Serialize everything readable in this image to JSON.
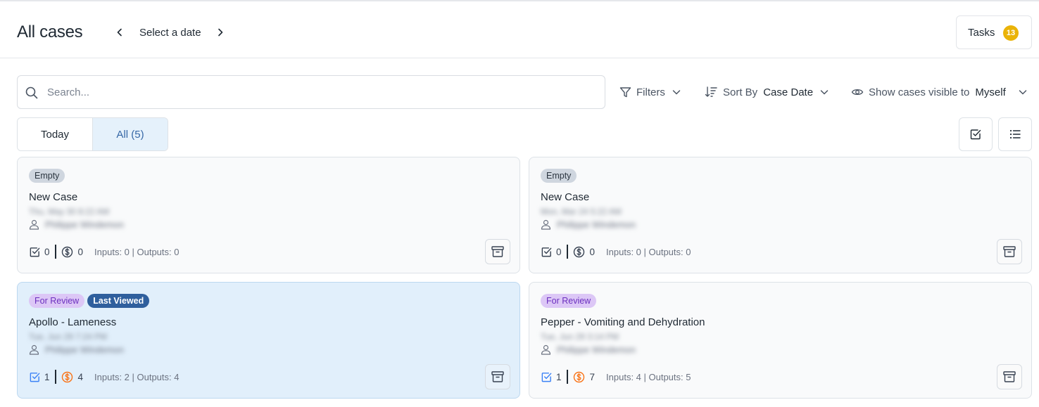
{
  "header": {
    "title": "All cases",
    "date_picker": {
      "label": "Select a date"
    },
    "tasks": {
      "label": "Tasks",
      "count": "13"
    }
  },
  "search": {
    "placeholder": "Search..."
  },
  "toolbar": {
    "filters_label": "Filters",
    "sort_label": "Sort By",
    "sort_value": "Case Date",
    "visibility_label": "Show cases visible to",
    "visibility_value": "Myself"
  },
  "tabs": [
    {
      "label": "Today",
      "selected": false
    },
    {
      "label": "All (5)",
      "selected": true
    }
  ],
  "cases": [
    {
      "badges": [
        {
          "label": "Empty",
          "kind": "empty"
        }
      ],
      "title": "New Case",
      "date": "Thu, May 30 8:22 AM",
      "owner": "Philippe Windemon",
      "tasks": "0",
      "credits": "0",
      "io": "Inputs: 0 | Outputs: 0",
      "active": false
    },
    {
      "badges": [
        {
          "label": "Empty",
          "kind": "empty"
        }
      ],
      "title": "New Case",
      "date": "Mon, Mar 24 5:22 AM",
      "owner": "Philippe Windemon",
      "tasks": "0",
      "credits": "0",
      "io": "Inputs: 0 | Outputs: 0",
      "active": false
    },
    {
      "badges": [
        {
          "label": "For Review",
          "kind": "review"
        },
        {
          "label": "Last Viewed",
          "kind": "lastviewed"
        }
      ],
      "title": "Apollo - Lameness",
      "date": "Tue, Jun 29 7:24 PM",
      "owner": "Philippe Windemon",
      "tasks": "1",
      "credits": "4",
      "io": "Inputs: 2 | Outputs: 4",
      "active": true
    },
    {
      "badges": [
        {
          "label": "For Review",
          "kind": "review"
        }
      ],
      "title": "Pepper - Vomiting and Dehydration",
      "date": "Tue, Jun 29 3:14 PM",
      "owner": "Philippe Windemon",
      "tasks": "1",
      "credits": "7",
      "io": "Inputs: 4 | Outputs: 5",
      "active": false
    }
  ],
  "colors": {
    "accent": "#3567a6",
    "tab_selected_bg": "#e5f1fb",
    "card_active_bg": "#e1effb",
    "tasks_badge": "#eab308",
    "task_icon_done": "#3b82f6",
    "credit_icon_active": "#f97316",
    "badge_review_bg": "#dcc7f6",
    "badge_lastviewed_bg": "#2f5f9d"
  },
  "icons": {
    "prev": "chevron-left-icon",
    "next": "chevron-right-icon",
    "search": "search-icon",
    "filters": "filter-icon",
    "sort": "sort-descending-icon",
    "visibility": "eye-icon",
    "dropdown": "chevron-down-icon",
    "select": "checkbox-icon",
    "list": "list-icon",
    "owner": "user-icon",
    "tasks": "checkbox-icon",
    "credits": "dollar-coin-icon",
    "archive": "archive-icon"
  }
}
